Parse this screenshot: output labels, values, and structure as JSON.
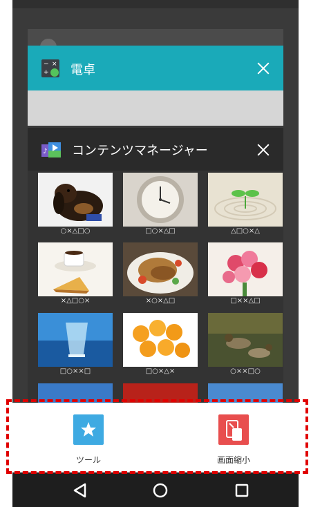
{
  "colors": {
    "calc_bar": "#1aaab9",
    "highlight_dash": "#e00000",
    "tool_icon_bg": "#3eaae2",
    "shrink_icon_bg": "#e84e4e"
  },
  "recents": {
    "calc_card": {
      "title": "電卓",
      "icon": "calculator-icon"
    },
    "content_card": {
      "title": "コンテンツマネージャー",
      "icon": "content-manager-icon",
      "thumbnails": [
        {
          "caption": "○×△□○",
          "subject": "dog"
        },
        {
          "caption": "□○×△□",
          "subject": "clock"
        },
        {
          "caption": "△□○×△",
          "subject": "sprout"
        },
        {
          "caption": "×△□○×",
          "subject": "coffee"
        },
        {
          "caption": "×○×△□",
          "subject": "food"
        },
        {
          "caption": "□××△□",
          "subject": "flowers"
        },
        {
          "caption": "□○××□",
          "subject": "glass-sea"
        },
        {
          "caption": "□○×△×",
          "subject": "oranges"
        },
        {
          "caption": "○××□○",
          "subject": "ducks"
        }
      ]
    }
  },
  "sheet": {
    "items": [
      {
        "label": "ツール",
        "icon": "star-icon"
      },
      {
        "label": "画面縮小",
        "icon": "shrink-screen-icon"
      }
    ]
  },
  "navbar": {
    "back": "back-icon",
    "home": "home-icon",
    "recents": "recents-icon"
  }
}
